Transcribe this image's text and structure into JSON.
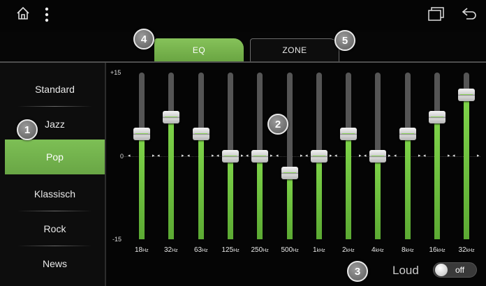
{
  "topbar": {
    "icons": [
      "home-icon",
      "more-vert-icon",
      "recent-apps-icon",
      "back-icon"
    ]
  },
  "tabs": [
    {
      "label": "EQ",
      "active": true
    },
    {
      "label": "ZONE",
      "active": false
    }
  ],
  "presets": [
    {
      "label": "Standard",
      "active": false
    },
    {
      "label": "Jazz",
      "active": false
    },
    {
      "label": "Pop",
      "active": true
    },
    {
      "label": "Klassisch",
      "active": false
    },
    {
      "label": "Rock",
      "active": false
    },
    {
      "label": "News",
      "active": false
    }
  ],
  "eq": {
    "max_label": "+15",
    "zero_label": "0",
    "min_label": "-15",
    "range": [
      -15,
      15
    ],
    "bands": [
      {
        "num": "18",
        "unit": "Hz",
        "level": 4
      },
      {
        "num": "32",
        "unit": "Hz",
        "level": 7
      },
      {
        "num": "63",
        "unit": "Hz",
        "level": 4
      },
      {
        "num": "125",
        "unit": "Hz",
        "level": 0
      },
      {
        "num": "250",
        "unit": "Hz",
        "level": 0
      },
      {
        "num": "500",
        "unit": "Hz",
        "level": -3
      },
      {
        "num": "1",
        "unit": "kHz",
        "level": 0
      },
      {
        "num": "2",
        "unit": "kHz",
        "level": 4
      },
      {
        "num": "4",
        "unit": "kHz",
        "level": 0
      },
      {
        "num": "8",
        "unit": "kHz",
        "level": 4
      },
      {
        "num": "16",
        "unit": "kHz",
        "level": 7
      },
      {
        "num": "32",
        "unit": "kHz",
        "level": 11
      }
    ]
  },
  "loud": {
    "label": "Loud",
    "state": "off"
  },
  "callouts": [
    "1",
    "2",
    "3",
    "4",
    "5"
  ],
  "colors": {
    "accent": "#72b04a",
    "fill": "#6cc23e"
  }
}
